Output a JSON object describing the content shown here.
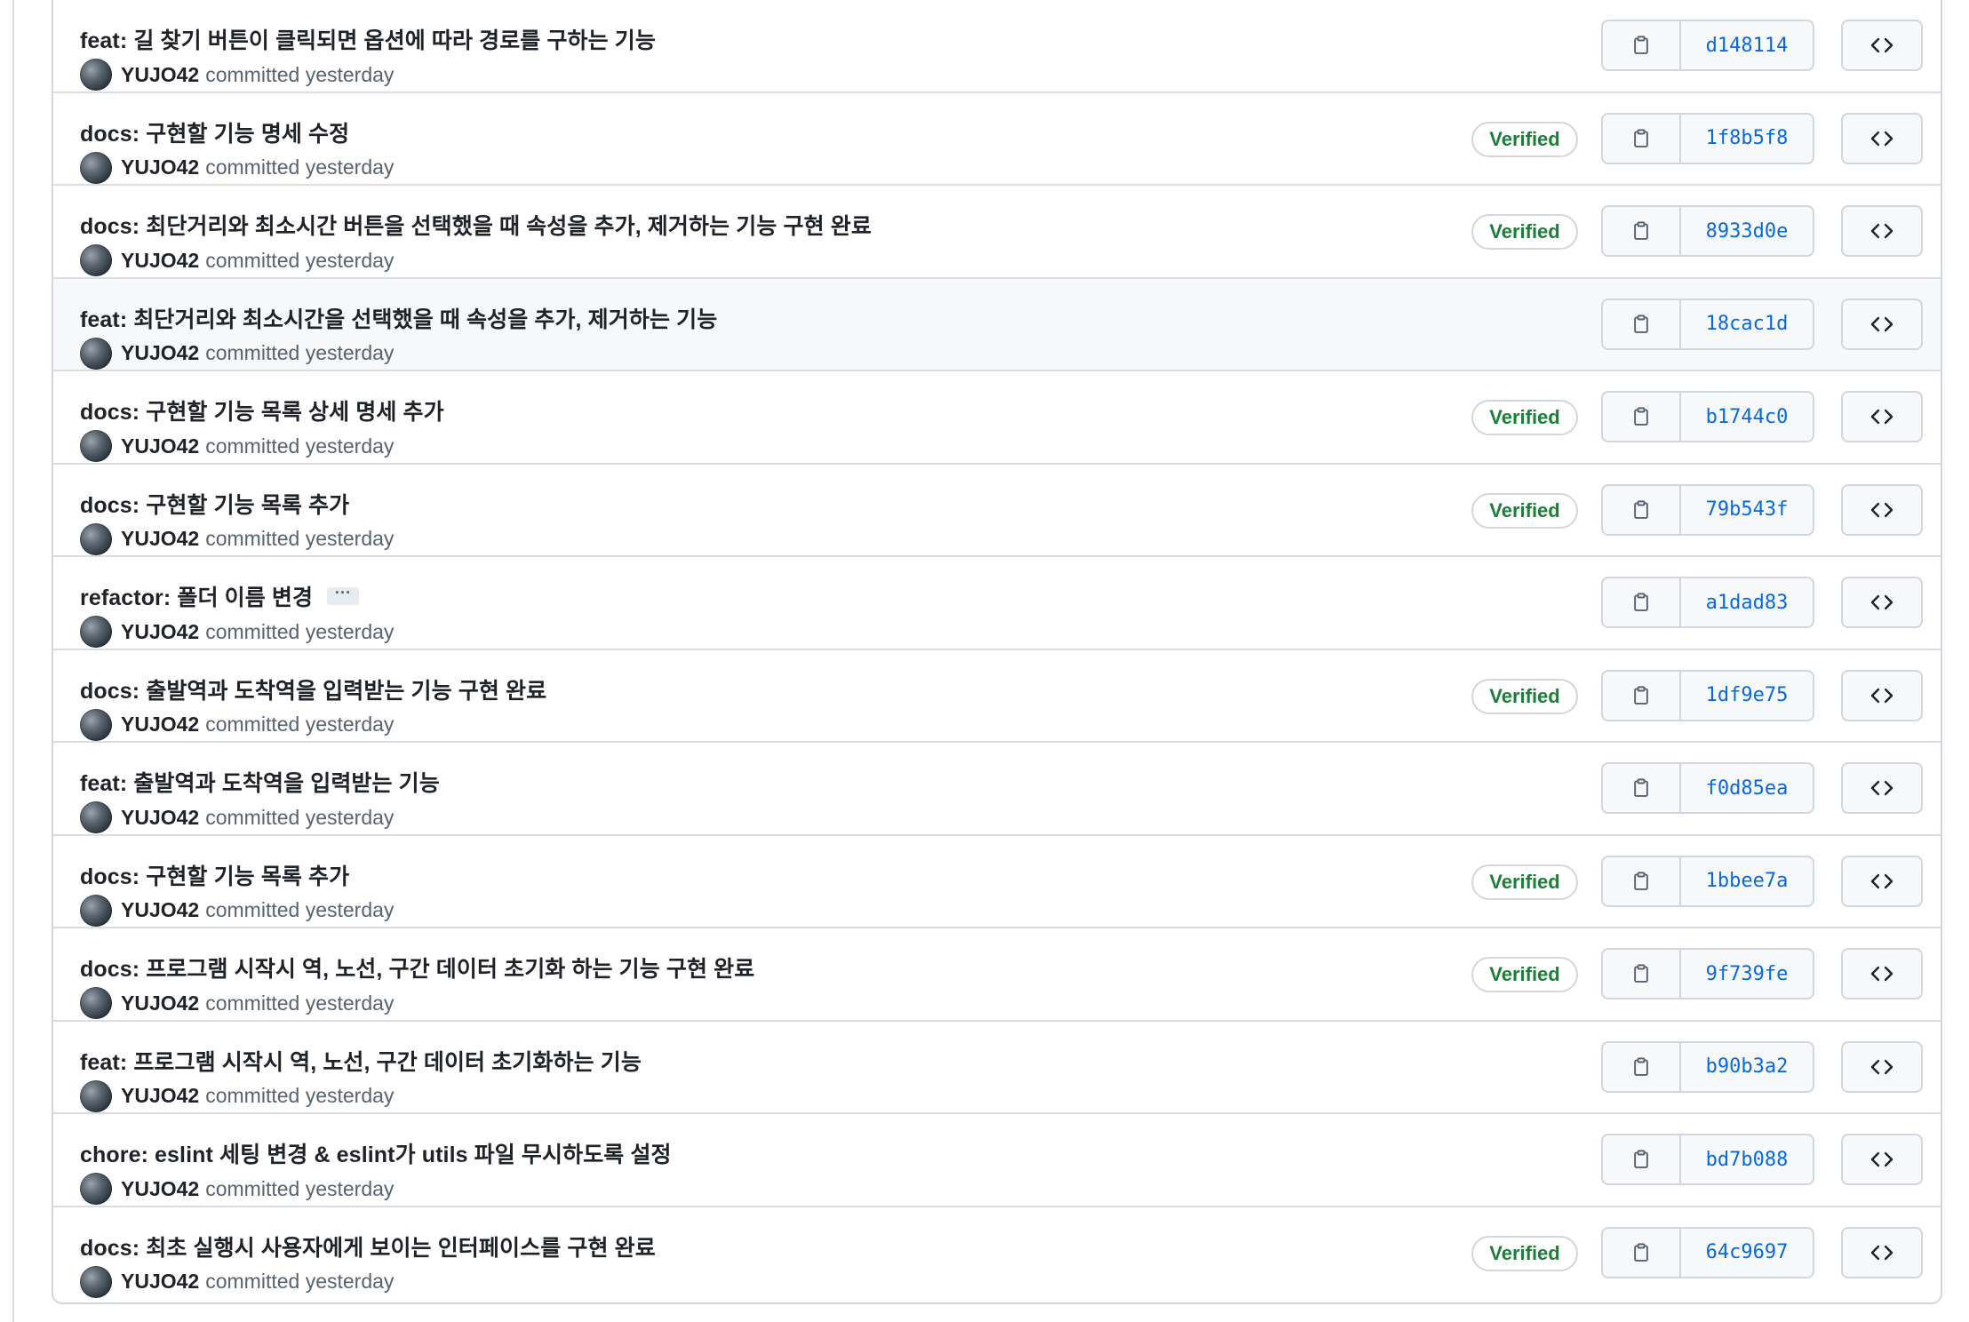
{
  "commits": [
    {
      "message": "feat: 길 찾기 버튼이 클릭되면 옵션에 따라 경로를 구하는 기능",
      "author": "YUJO42",
      "time": "committed yesterday",
      "verified": false,
      "sha": "d148114",
      "has_ellipsis": false,
      "highlight": false
    },
    {
      "message": "docs: 구현할 기능 명세 수정",
      "author": "YUJO42",
      "time": "committed yesterday",
      "verified": true,
      "sha": "1f8b5f8",
      "has_ellipsis": false,
      "highlight": false
    },
    {
      "message": "docs: 최단거리와 최소시간 버튼을 선택했을 때 속성을 추가, 제거하는 기능 구현 완료",
      "author": "YUJO42",
      "time": "committed yesterday",
      "verified": true,
      "sha": "8933d0e",
      "has_ellipsis": false,
      "highlight": false
    },
    {
      "message": "feat: 최단거리와 최소시간을 선택했을 때 속성을 추가, 제거하는 기능",
      "author": "YUJO42",
      "time": "committed yesterday",
      "verified": false,
      "sha": "18cac1d",
      "has_ellipsis": false,
      "highlight": true
    },
    {
      "message": "docs: 구현할 기능 목록 상세 명세 추가",
      "author": "YUJO42",
      "time": "committed yesterday",
      "verified": true,
      "sha": "b1744c0",
      "has_ellipsis": false,
      "highlight": false
    },
    {
      "message": "docs: 구현할 기능 목록 추가",
      "author": "YUJO42",
      "time": "committed yesterday",
      "verified": true,
      "sha": "79b543f",
      "has_ellipsis": false,
      "highlight": false
    },
    {
      "message": "refactor: 폴더 이름 변경",
      "author": "YUJO42",
      "time": "committed yesterday",
      "verified": false,
      "sha": "a1dad83",
      "has_ellipsis": true,
      "highlight": false
    },
    {
      "message": "docs: 출발역과 도착역을 입력받는 기능 구현 완료",
      "author": "YUJO42",
      "time": "committed yesterday",
      "verified": true,
      "sha": "1df9e75",
      "has_ellipsis": false,
      "highlight": false
    },
    {
      "message": "feat: 출발역과 도착역을 입력받는 기능",
      "author": "YUJO42",
      "time": "committed yesterday",
      "verified": false,
      "sha": "f0d85ea",
      "has_ellipsis": false,
      "highlight": false
    },
    {
      "message": "docs: 구현할 기능 목록 추가",
      "author": "YUJO42",
      "time": "committed yesterday",
      "verified": true,
      "sha": "1bbee7a",
      "has_ellipsis": false,
      "highlight": false
    },
    {
      "message": "docs: 프로그램 시작시 역, 노선, 구간 데이터 초기화 하는 기능 구현 완료",
      "author": "YUJO42",
      "time": "committed yesterday",
      "verified": true,
      "sha": "9f739fe",
      "has_ellipsis": false,
      "highlight": false
    },
    {
      "message": "feat: 프로그램 시작시 역, 노선, 구간 데이터 초기화하는 기능",
      "author": "YUJO42",
      "time": "committed yesterday",
      "verified": false,
      "sha": "b90b3a2",
      "has_ellipsis": false,
      "highlight": false
    },
    {
      "message": "chore: eslint 세팅 변경 & eslint가 utils 파일 무시하도록 설정",
      "author": "YUJO42",
      "time": "committed yesterday",
      "verified": false,
      "sha": "bd7b088",
      "has_ellipsis": false,
      "highlight": false
    },
    {
      "message": "docs: 최초 실행시 사용자에게 보이는 인터페이스를 구현 완료",
      "author": "YUJO42",
      "time": "committed yesterday",
      "verified": true,
      "sha": "64c9697",
      "has_ellipsis": false,
      "highlight": false
    }
  ],
  "labels": {
    "verified": "Verified",
    "ellipsis": "···"
  },
  "icons": {
    "copy": "clipboard-icon",
    "browse": "code-icon"
  },
  "colors": {
    "link": "#0969da",
    "verified": "#1a7f37",
    "highlight_row": "#f6f8fa"
  }
}
